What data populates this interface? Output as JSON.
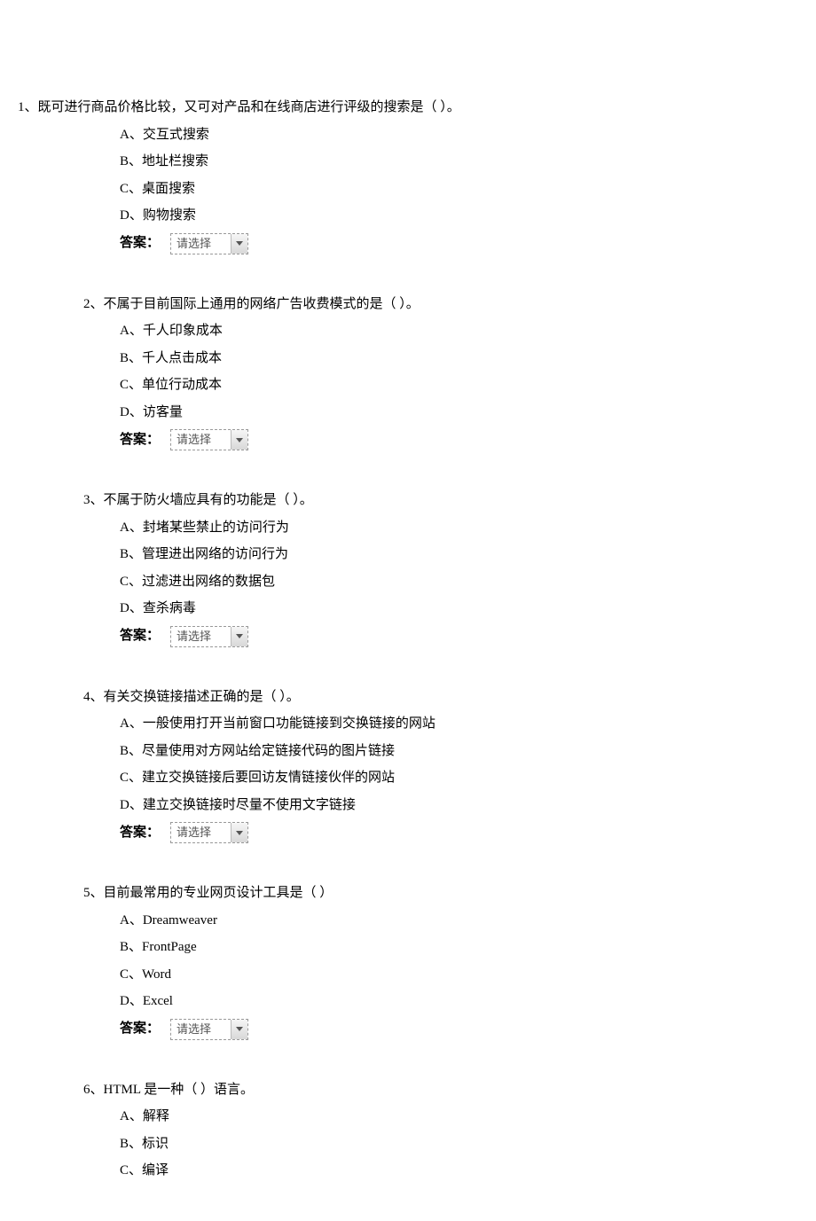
{
  "answer_label": "答案：",
  "select_placeholder": "请选择",
  "questions": [
    {
      "number": "1、",
      "text": "既可进行商品价格比较，又可对产品和在线商店进行评级的搜索是（ ）。",
      "options": [
        "A、交互式搜索",
        "B、地址栏搜索",
        "C、桌面搜索",
        "D、购物搜索"
      ]
    },
    {
      "number": "2、",
      "text": "不属于目前国际上通用的网络广告收费模式的是（ ）。",
      "options": [
        "A、千人印象成本",
        "B、千人点击成本",
        "C、单位行动成本",
        "D、访客量"
      ]
    },
    {
      "number": "3、",
      "text": "不属于防火墙应具有的功能是（ ）。",
      "options": [
        "A、封堵某些禁止的访问行为",
        "B、管理进出网络的访问行为",
        "C、过滤进出网络的数据包",
        "D、查杀病毒"
      ]
    },
    {
      "number": "4、",
      "text": "有关交换链接描述正确的是（ ）。",
      "options": [
        "A、一般使用打开当前窗口功能链接到交换链接的网站",
        "B、尽量使用对方网站给定链接代码的图片链接",
        "C、建立交换链接后要回访友情链接伙伴的网站",
        "D、建立交换链接时尽量不使用文字链接"
      ]
    },
    {
      "number": "5、",
      "text": "目前最常用的专业网页设计工具是（ ）",
      "options": [
        "A、Dreamweaver",
        "B、FrontPage",
        "C、Word",
        "D、Excel"
      ]
    },
    {
      "number": "6、",
      "text": "HTML 是一种（ ）语言。",
      "options": [
        "A、解释",
        "B、标识",
        "C、编译"
      ]
    }
  ]
}
